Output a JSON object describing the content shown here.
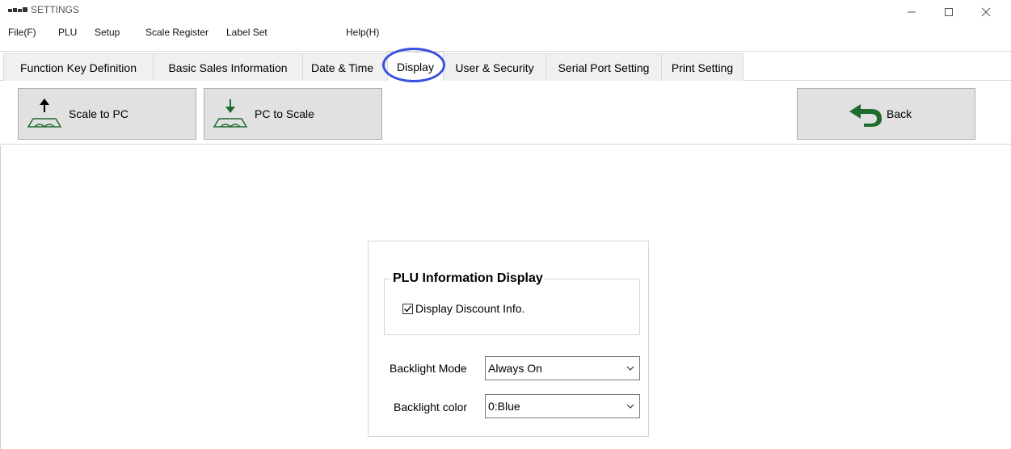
{
  "window": {
    "title": "SETTINGS",
    "controls": {
      "minimize": "—",
      "maximize": "□",
      "close": "×"
    }
  },
  "menu": [
    {
      "label": "File(F)"
    },
    {
      "label": "PLU"
    },
    {
      "label": "Setup"
    },
    {
      "label": "Scale Register"
    },
    {
      "label": "Label Set"
    },
    {
      "label": "Help(H)"
    }
  ],
  "tabs": [
    {
      "label": "Function Key Definition"
    },
    {
      "label": "Basic Sales Information"
    },
    {
      "label": "Date & Time"
    },
    {
      "label": "Display",
      "active": true
    },
    {
      "label": "User & Security"
    },
    {
      "label": "Serial Port Setting"
    },
    {
      "label": "Print Setting"
    }
  ],
  "toolbar": {
    "scale_to_pc": {
      "label": "Scale to PC",
      "icon": "scale-upload-icon"
    },
    "pc_to_scale": {
      "label": "PC to Scale",
      "icon": "scale-download-icon"
    },
    "back": {
      "label": "Back",
      "icon": "back-arrow-icon"
    }
  },
  "display_panel": {
    "group_title": "PLU Information Display",
    "discount_checkbox": {
      "label": "Display Discount Info.",
      "checked": true
    },
    "backlight_mode": {
      "label": "Backlight Mode",
      "value": "Always On"
    },
    "backlight_color": {
      "label": "Backlight color",
      "value": "0:Blue"
    }
  },
  "colors": {
    "highlight_circle": "#3a4fe0",
    "button_face": "#e1e1e1",
    "arrow_green": "#1e6b2e"
  }
}
